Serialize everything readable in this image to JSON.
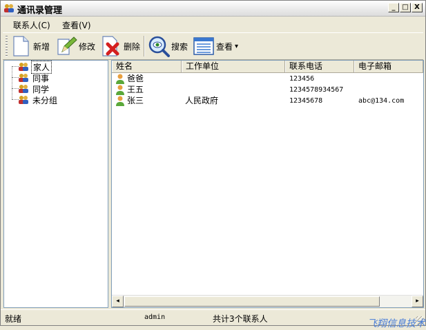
{
  "window": {
    "title": "通讯录管理",
    "minimize": "_",
    "maximize": "□",
    "close": "X"
  },
  "menu": [
    {
      "label": "联系人(C)"
    },
    {
      "label": "查看(V)"
    }
  ],
  "toolbar": {
    "add": "新增",
    "edit": "修改",
    "delete": "删除",
    "search": "搜索",
    "view": "查看",
    "view_arrow": "▾"
  },
  "groups": [
    {
      "label": "家人"
    },
    {
      "label": "同事"
    },
    {
      "label": "同学"
    },
    {
      "label": "未分组"
    }
  ],
  "columns": [
    "姓名",
    "工作单位",
    "联系电话",
    "电子邮箱"
  ],
  "contacts": [
    {
      "name": "爸爸",
      "company": "",
      "phone": "123456",
      "email": ""
    },
    {
      "name": "王五",
      "company": "",
      "phone": "1234578934567",
      "email": ""
    },
    {
      "name": "张三",
      "company": "人民政府",
      "phone": "12345678",
      "email": "abc@134.com"
    }
  ],
  "scroll": {
    "left": "◂",
    "right": "▸"
  },
  "status": {
    "state": "就绪",
    "user": "admin",
    "count": "共计3个联系人"
  },
  "watermark": "飞翔信息技术",
  "colors": {
    "border": "#7f9db9",
    "face": "#ece9d8",
    "accent": "#4a7ed8"
  }
}
